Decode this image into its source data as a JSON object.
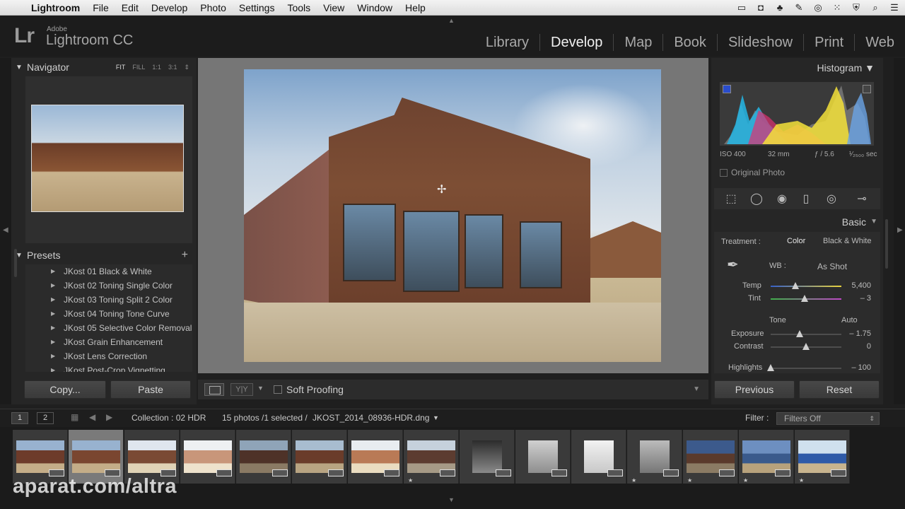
{
  "menubar": {
    "items": [
      "Lightroom",
      "File",
      "Edit",
      "Develop",
      "Photo",
      "Settings",
      "Tools",
      "View",
      "Window",
      "Help"
    ]
  },
  "identity": {
    "adobe": "Adobe",
    "name": "Lightroom CC",
    "mark": "Lr"
  },
  "modules": [
    "Library",
    "Develop",
    "Map",
    "Book",
    "Slideshow",
    "Print",
    "Web"
  ],
  "active_module": "Develop",
  "navigator": {
    "title": "Navigator",
    "zoom": [
      "FIT",
      "FILL",
      "1:1",
      "3:1"
    ]
  },
  "presets": {
    "title": "Presets",
    "items": [
      "JKost 01 Black & White",
      "JKost 02 Toning Single Color",
      "JKost 03 Toning Split 2 Color",
      "JKost 04 Toning Tone Curve",
      "JKost 05 Selective Color Removal",
      "JKost Grain Enhancement",
      "JKost Lens Correction",
      "JKost Post-Crop Vignetting"
    ]
  },
  "left_buttons": {
    "copy": "Copy...",
    "paste": "Paste"
  },
  "toolbar": {
    "compare": "Y|Y",
    "soft_proofing": "Soft Proofing"
  },
  "histogram": {
    "title": "Histogram",
    "iso": "ISO 400",
    "focal": "32 mm",
    "aperture": "ƒ / 5.6",
    "shutter": "¹⁄₂₅₀₀ sec",
    "original_photo": "Original Photo"
  },
  "basic": {
    "title": "Basic",
    "treatment_label": "Treatment :",
    "color": "Color",
    "bw": "Black & White",
    "wb_label": "WB :",
    "wb_value": "As Shot",
    "temp_label": "Temp",
    "temp_value": "5,400",
    "temp_pos": 0.35,
    "tint_label": "Tint",
    "tint_value": "– 3",
    "tint_pos": 0.48,
    "tone_label": "Tone",
    "auto": "Auto",
    "exposure_label": "Exposure",
    "exposure_value": "– 1.75",
    "exposure_pos": 0.41,
    "contrast_label": "Contrast",
    "contrast_value": "0",
    "contrast_pos": 0.5,
    "highlights_label": "Highlights",
    "highlights_value": "– 100",
    "highlights_pos": 0.0
  },
  "right_buttons": {
    "previous": "Previous",
    "reset": "Reset"
  },
  "filmbar": {
    "page1": "1",
    "page2": "2",
    "collection": "Collection : 02 HDR",
    "count": "15 photos /1 selected /",
    "filename": "JKOST_2014_08936-HDR.dng",
    "filter_label": "Filter :",
    "filter_value": "Filters Off"
  },
  "watermark": "aparat.com/altra",
  "colors": {
    "accent": "#f0f0f0",
    "panel": "#262626",
    "background": "#1f1f1f"
  }
}
